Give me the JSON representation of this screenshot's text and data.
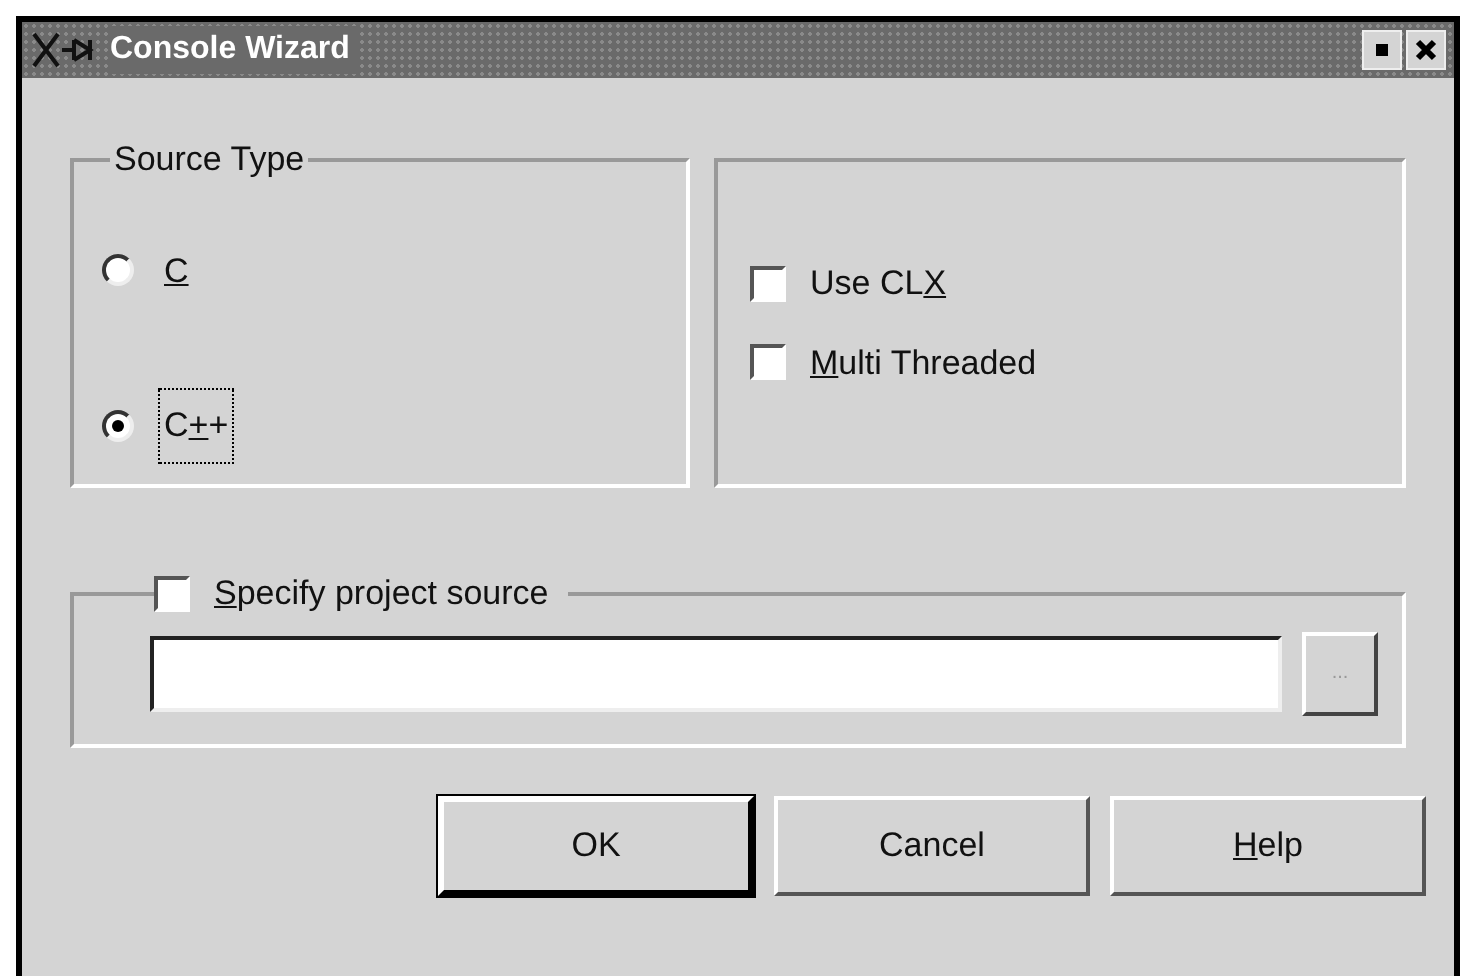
{
  "window": {
    "title": "Console Wizard"
  },
  "source_type": {
    "title": "Source Type",
    "options": [
      {
        "label": {
          "key": "C"
        },
        "selected": false,
        "focused": false
      },
      {
        "label": {
          "before": "C",
          "key": "+",
          "after": "+"
        },
        "selected": true,
        "focused": true
      }
    ]
  },
  "options": [
    {
      "label": {
        "before": "Use CL",
        "key": "X"
      },
      "checked": false
    },
    {
      "label": {
        "key": "M",
        "after": "ulti Threaded"
      },
      "checked": false
    }
  ],
  "project_source": {
    "label": {
      "key": "S",
      "after": "pecify project source"
    },
    "checked": false,
    "browse": "..."
  },
  "buttons": [
    {
      "label": {
        "before": "OK"
      },
      "default": true
    },
    {
      "label": {
        "before": "Cancel"
      },
      "default": false
    },
    {
      "label": {
        "key": "H",
        "after": "elp"
      },
      "default": false
    }
  ]
}
